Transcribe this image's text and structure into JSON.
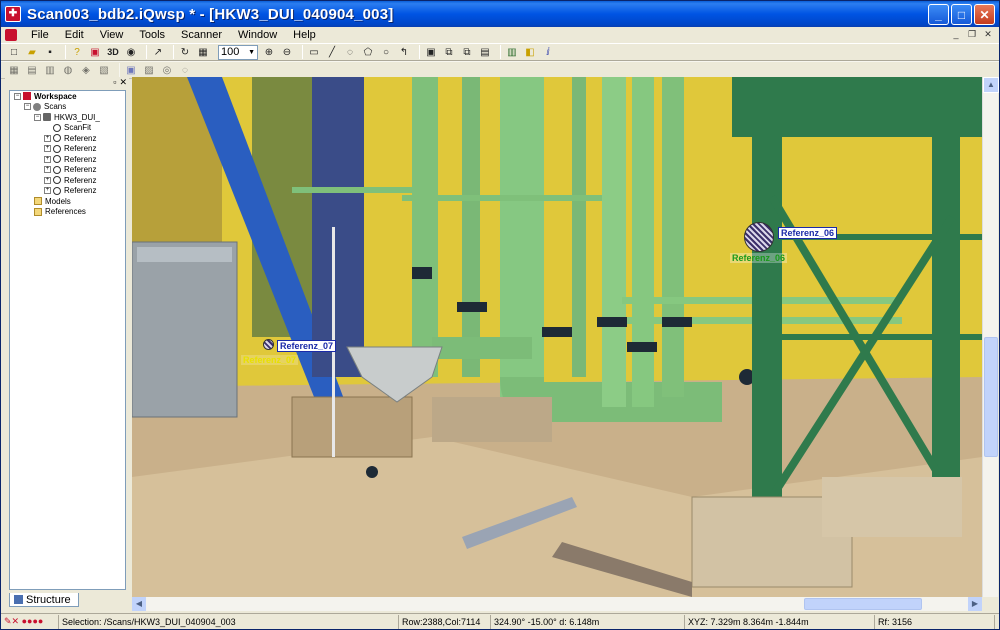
{
  "window": {
    "title": "Scan003_bdb2.iQwsp * - [HKW3_DUI_040904_003]",
    "buttons": {
      "minimize": "_",
      "maximize": "□",
      "close": "✕"
    }
  },
  "menu": {
    "items": [
      "File",
      "Edit",
      "View",
      "Tools",
      "Scanner",
      "Window",
      "Help"
    ]
  },
  "toolbar": {
    "zoom_value": "100",
    "icon_3d": "3D"
  },
  "tree": {
    "items": [
      {
        "label": "Workspace",
        "bold": true,
        "icon": "workspace-icon"
      },
      {
        "label": "Scans",
        "icon": "scans-icon"
      },
      {
        "label": "HKW3_DUI_",
        "icon": "scan-icon"
      },
      {
        "label": "ScanFit",
        "icon": "scanfit-icon"
      },
      {
        "label": "Referenz",
        "icon": "reference-icon"
      },
      {
        "label": "Referenz",
        "icon": "reference-icon"
      },
      {
        "label": "Referenz",
        "icon": "reference-icon"
      },
      {
        "label": "Referenz",
        "icon": "reference-icon"
      },
      {
        "label": "Referenz",
        "icon": "reference-icon"
      },
      {
        "label": "Referenz",
        "icon": "reference-icon"
      },
      {
        "label": "Models",
        "icon": "folder-icon"
      },
      {
        "label": "References",
        "icon": "folder-icon"
      }
    ],
    "tab_label": "Structure"
  },
  "viewport": {
    "labels": {
      "ref06_blue": "Referenz_06",
      "ref06_green": "Referenz_06",
      "ref07_blue": "Referenz_07",
      "ref07_yellow": "Referenz_07"
    }
  },
  "status": {
    "selection": "Selection: /Scans/HKW3_DUI_040904_003",
    "rowcol": "Row:2388,Col:7114",
    "angles": "324.90° -15.00°  d: 6.148m",
    "xyz": "XYZ: 7.329m 8.364m -1.844m",
    "rf": "Rf: 3156"
  }
}
